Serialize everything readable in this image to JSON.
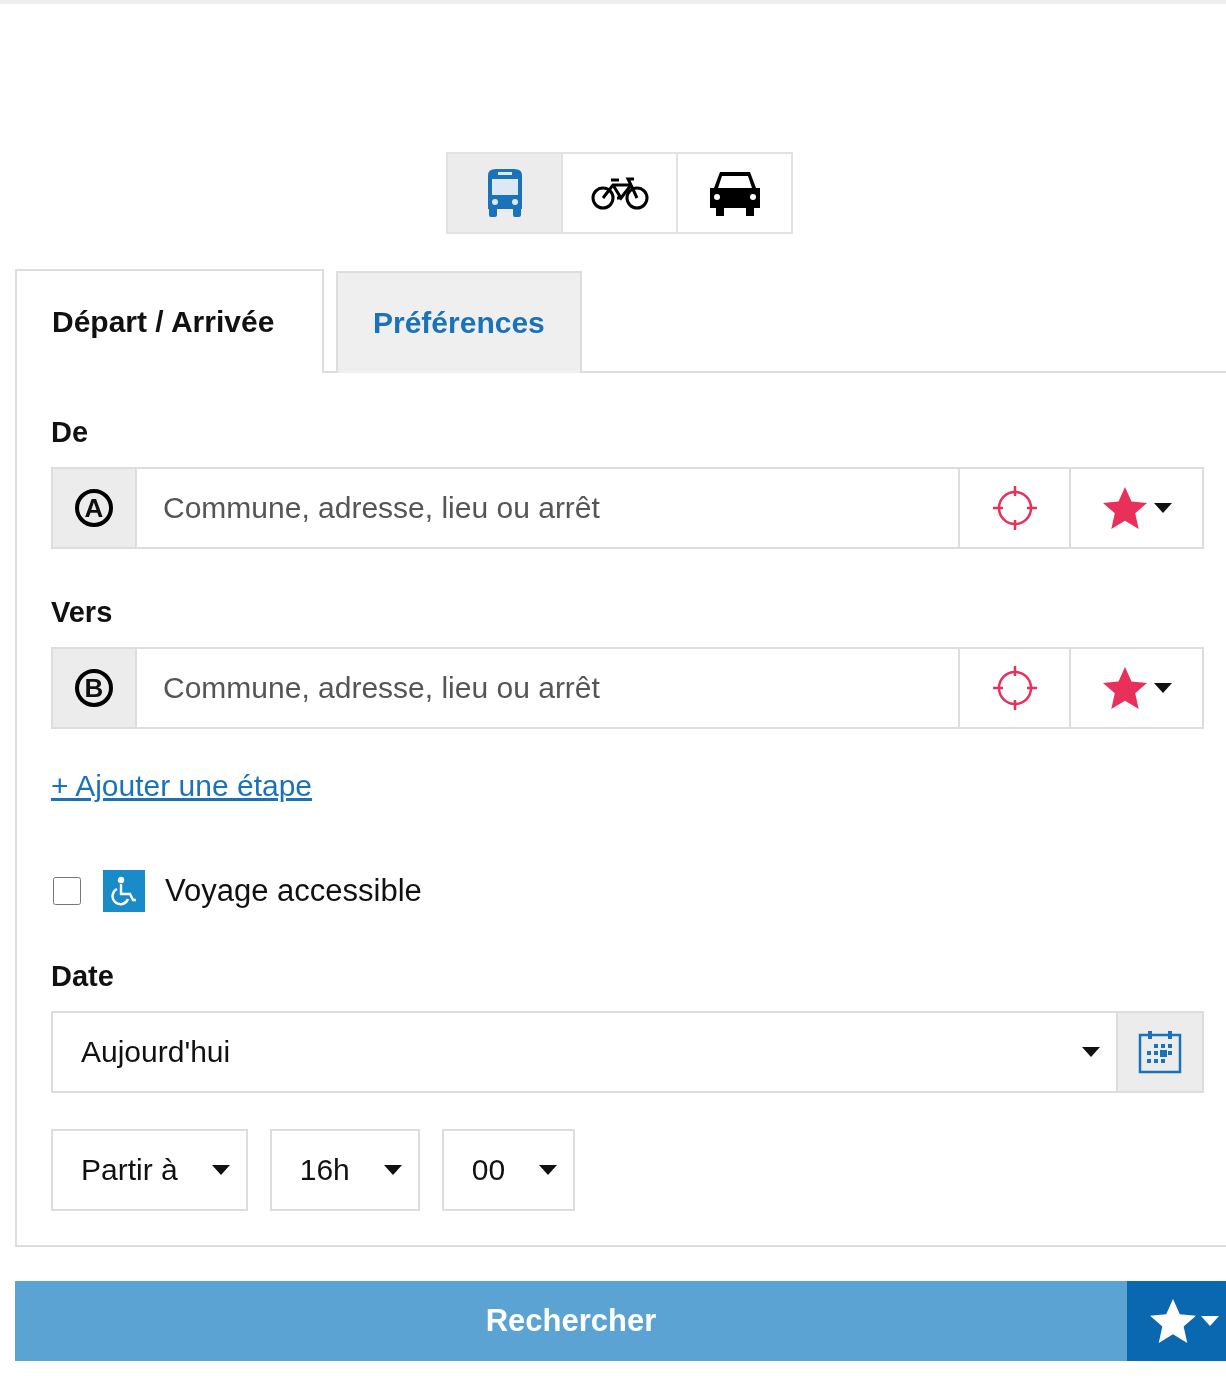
{
  "modes": [
    {
      "kind": "bus",
      "selected": true
    },
    {
      "kind": "bike",
      "selected": false
    },
    {
      "kind": "car",
      "selected": false
    }
  ],
  "tabs": [
    {
      "label": "Départ / Arrivée",
      "selected": true
    },
    {
      "label": "Préférences",
      "selected": false
    }
  ],
  "places": [
    {
      "label": "De",
      "marker": "A",
      "placeholder": "Commune, adresse, lieu ou arrêt"
    },
    {
      "label": "Vers",
      "marker": "B",
      "placeholder": "Commune, adresse, lieu ou arrêt"
    }
  ],
  "add_stop_link": "+ Ajouter une étape",
  "accessible": {
    "label": "Voyage accessible",
    "checked": false
  },
  "date": {
    "label": "Date",
    "value": "Aujourd'hui"
  },
  "time_selects": [
    "Partir à",
    "16h",
    "00"
  ],
  "search_button": "Rechercher"
}
